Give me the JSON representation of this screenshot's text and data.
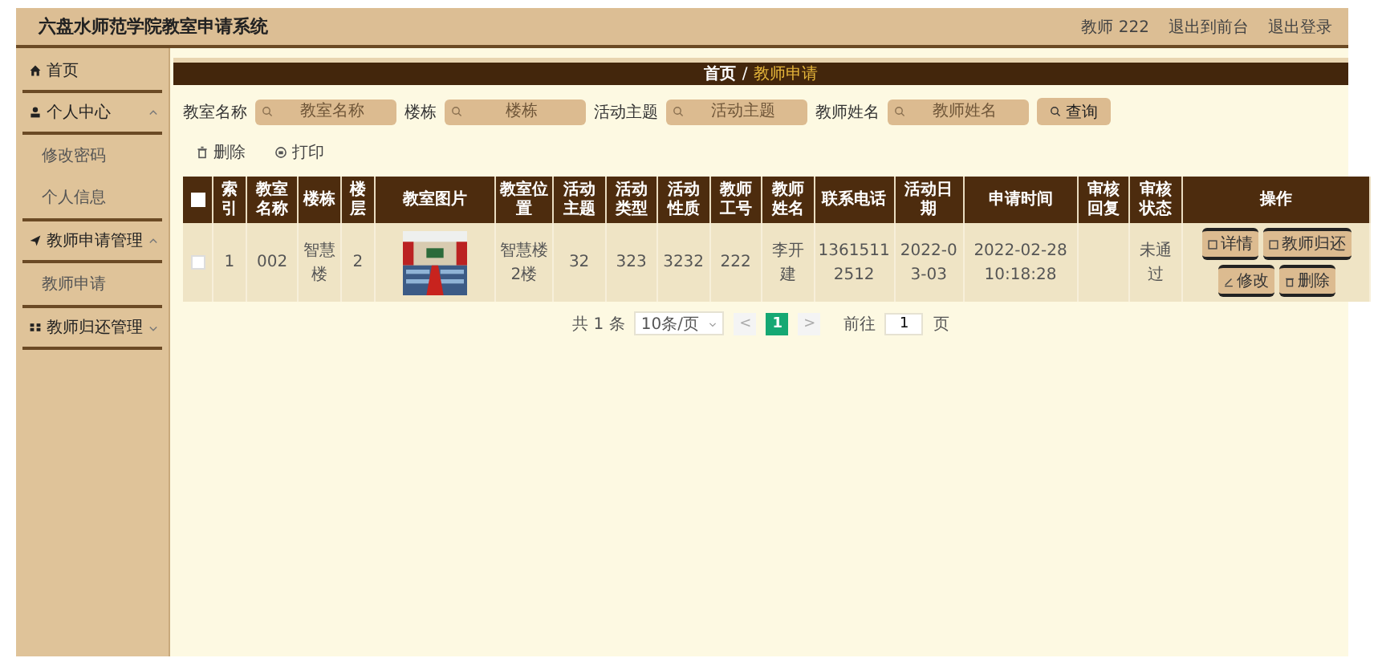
{
  "header": {
    "title": "六盘水师范学院教室申请系统",
    "user": "教师 222",
    "links": [
      "退出到前台",
      "退出登录"
    ]
  },
  "sidebar": {
    "items": [
      {
        "label": "首页"
      },
      {
        "label": "个人中心",
        "expanded": true,
        "children": [
          {
            "label": "修改密码"
          },
          {
            "label": "个人信息"
          }
        ]
      },
      {
        "label": "教师申请管理",
        "expanded": true,
        "children": [
          {
            "label": "教师申请"
          }
        ]
      },
      {
        "label": "教师归还管理",
        "expanded": false
      }
    ]
  },
  "breadcrumb": {
    "home": "首页",
    "separator": "/",
    "current": "教师申请"
  },
  "search": {
    "fields": [
      {
        "label": "教室名称",
        "placeholder": "教室名称"
      },
      {
        "label": "楼栋",
        "placeholder": "楼栋"
      },
      {
        "label": "活动主题",
        "placeholder": "活动主题"
      },
      {
        "label": "教师姓名",
        "placeholder": "教师姓名"
      }
    ],
    "button": "查询"
  },
  "actions": [
    "删除",
    "打印"
  ],
  "table": {
    "select_all": {
      "checked": false
    },
    "columns": [
      "索引",
      "教室名称",
      "楼栋",
      "楼层",
      "教室图片",
      "教室位置",
      "活动主题",
      "活动类型",
      "活动性质",
      "教师工号",
      "教师姓名",
      "联系电话",
      "活动日期",
      "申请时间",
      "审核回复",
      "审核状态",
      "操作"
    ],
    "rows": [
      {
        "checked": false,
        "cells": [
          {
            "kind": "text",
            "text": "1"
          },
          {
            "kind": "text",
            "text": "002"
          },
          {
            "kind": "text",
            "text": "智慧楼"
          },
          {
            "kind": "text",
            "text": "2"
          },
          {
            "kind": "picture"
          },
          {
            "kind": "text",
            "text": "智慧楼2楼"
          },
          {
            "kind": "text",
            "text": "32"
          },
          {
            "kind": "text",
            "text": "323"
          },
          {
            "kind": "text",
            "text": "3232"
          },
          {
            "kind": "text",
            "text": "222"
          },
          {
            "kind": "text",
            "text": "李开建"
          },
          {
            "kind": "text",
            "text": "13615112512"
          },
          {
            "kind": "text",
            "text": "2022-03-03"
          },
          {
            "kind": "text",
            "text": "2022-02-28 10:18:28"
          },
          {
            "kind": "empty"
          },
          {
            "kind": "text",
            "text": "未通过"
          },
          {
            "kind": "buttons",
            "buttons": [
              "详情",
              "教师归还",
              "修改",
              "删除"
            ]
          }
        ]
      }
    ]
  },
  "pagination": {
    "total": "共 1 条",
    "page_size": "10条/页",
    "prev": "<",
    "next": ">",
    "pages": [
      {
        "label": "1",
        "selected": true
      }
    ],
    "goto_label": "前往",
    "goto_value": "1",
    "goto_suffix": "页"
  }
}
